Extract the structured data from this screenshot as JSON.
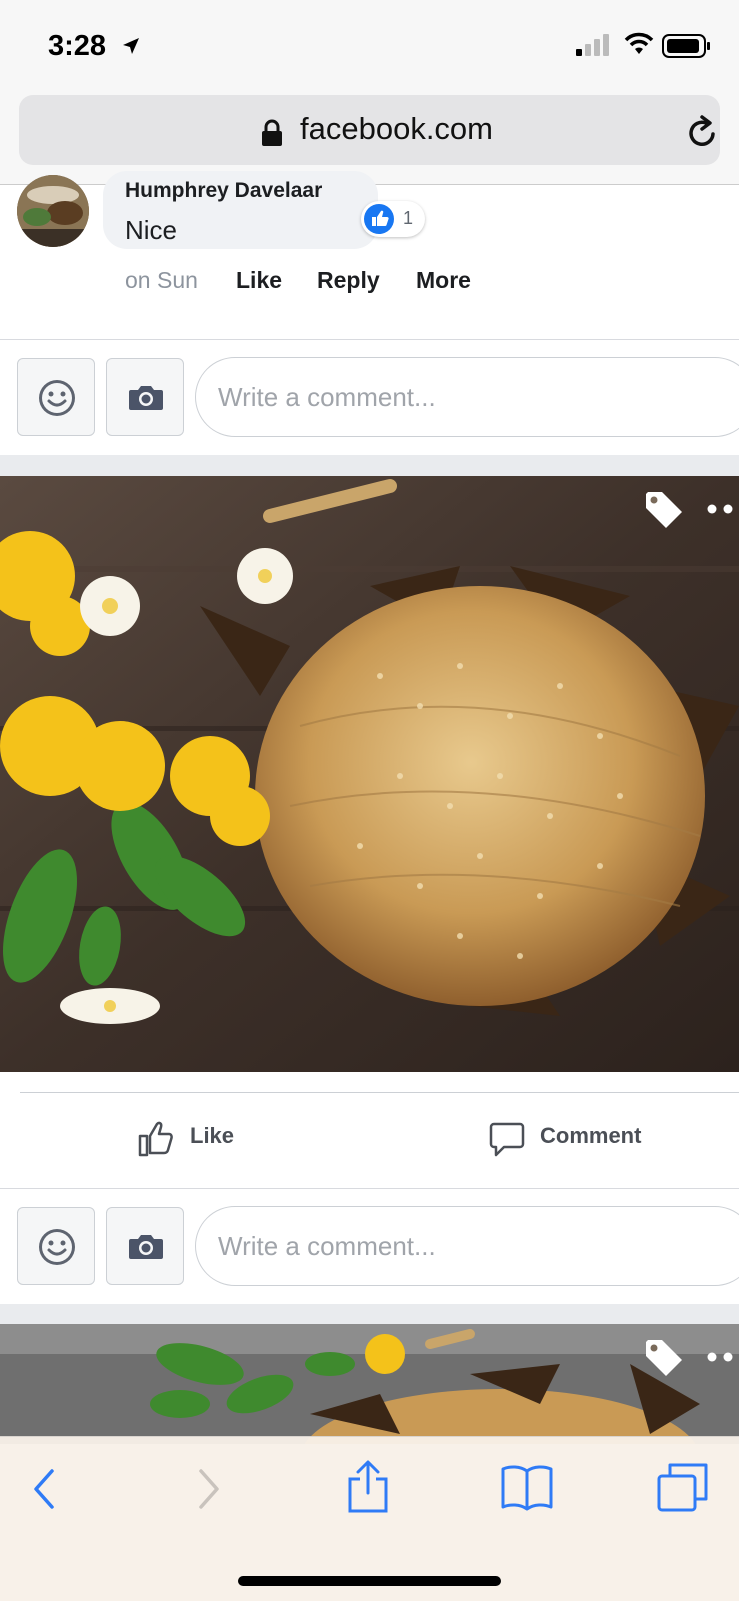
{
  "status": {
    "time": "3:28"
  },
  "browser": {
    "url": "facebook.com"
  },
  "comment": {
    "author": "Humphrey Davelaar",
    "text": "Nice",
    "reaction_count": "1",
    "time": "on Sun",
    "actions": {
      "like": "Like",
      "reply": "Reply",
      "more": "More"
    }
  },
  "composer": {
    "placeholder": "Write a comment..."
  },
  "post": {
    "like_label": "Like",
    "comment_label": "Comment"
  },
  "colors": {
    "fb_blue": "#1877f2",
    "ios_blue": "#2f7bf6",
    "text_dark": "#1c1e21",
    "text_muted": "#8d949e"
  },
  "icons": [
    "location-arrow-icon",
    "signal-icon",
    "wifi-icon",
    "battery-icon",
    "lock-icon",
    "reload-icon",
    "thumbs-up-icon",
    "smiley-icon",
    "camera-icon",
    "tag-icon",
    "more-dots-icon",
    "comment-icon",
    "back-icon",
    "forward-icon",
    "share-icon",
    "bookmarks-icon",
    "tabs-icon"
  ]
}
